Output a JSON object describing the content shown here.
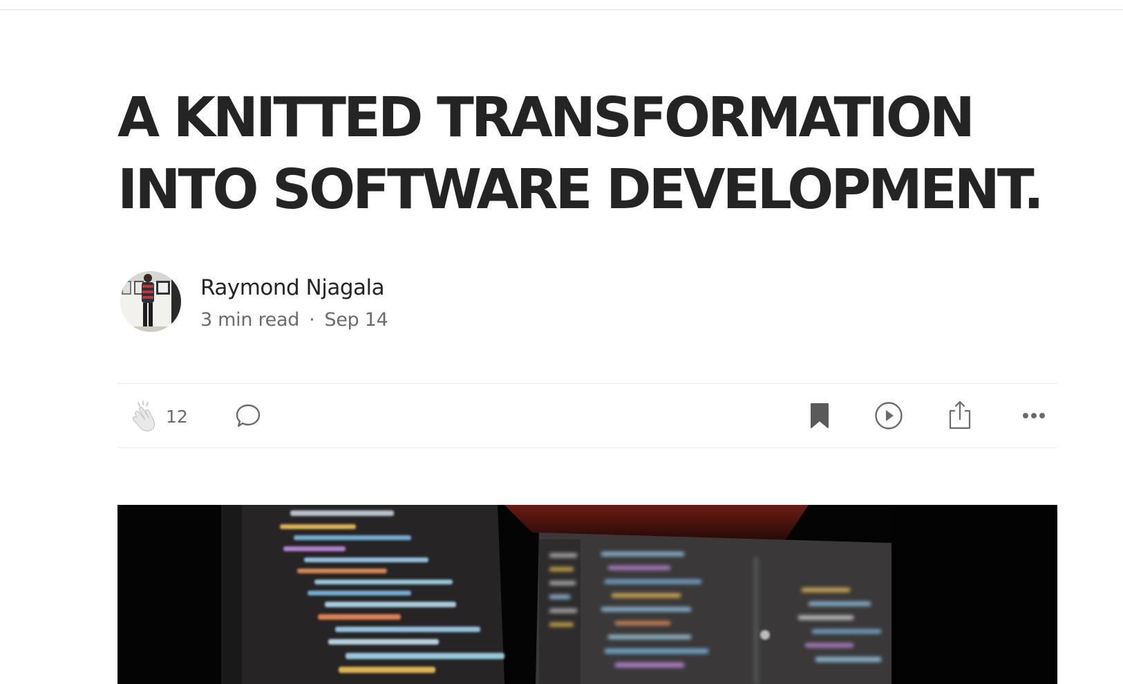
{
  "article": {
    "title_line1": "A KNITTED TRANSFORMATION",
    "title_line2": "INTO SOFTWARE DEVELOPMENT."
  },
  "author": {
    "name": "Raymond Njagala",
    "read_time": "3 min read",
    "separator": "·",
    "date": "Sep 14"
  },
  "actions": {
    "clap_count": "12",
    "icons": [
      "clap-icon",
      "comment-icon",
      "bookmark-icon",
      "play-icon",
      "share-icon",
      "more-icon"
    ]
  },
  "colors": {
    "text": "#242424",
    "muted": "#6b6b6b",
    "divider": "#ececec"
  }
}
